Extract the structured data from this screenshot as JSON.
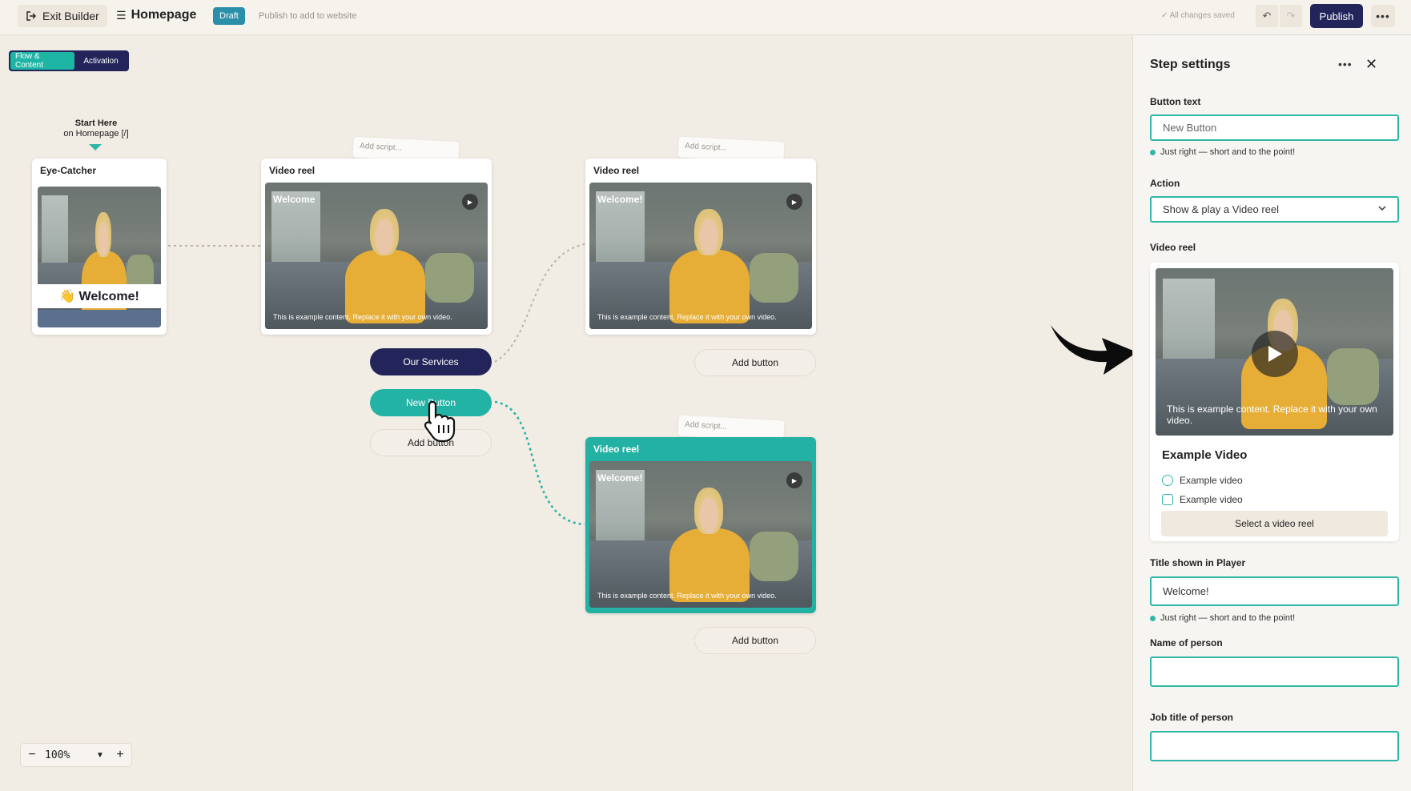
{
  "topbar": {
    "exit_label": "Exit Builder",
    "page_title": "Homepage",
    "draft_badge": "Draft",
    "publish_hint": "Publish to add to website",
    "saved_status": "✓ All changes saved",
    "undo_icon": "↶",
    "redo_icon": "↷",
    "publish_label": "Publish",
    "more_icon": "•••"
  },
  "mode_toggle": {
    "tabs": [
      {
        "label": "Flow & Content",
        "active": true
      },
      {
        "label": "Activation",
        "active": false
      }
    ]
  },
  "canvas": {
    "start": {
      "title": "Start Here",
      "subtitle": "on Homepage [/]"
    },
    "eye_catcher": {
      "title": "Eye-Catcher",
      "welcome": "👋 Welcome!"
    },
    "add_script_label": "Add script...",
    "video_nodes": [
      {
        "title": "Video reel",
        "video_title": "Welcome",
        "caption": "This is example content. Replace it with your own video."
      },
      {
        "title": "Video reel",
        "video_title": "Welcome!",
        "caption": "This is example content. Replace it with your own video."
      },
      {
        "title": "Video reel",
        "video_title": "Welcome!",
        "caption": "This is example content. Replace it with your own video."
      }
    ],
    "buttons": {
      "our_services": "Our Services",
      "new_button": "New Button",
      "add_button": "Add button"
    },
    "zoom": {
      "minus": "−",
      "value": "100%",
      "dropdown": "▼",
      "plus": "+"
    }
  },
  "panel": {
    "title": "Step settings",
    "more_icon": "•••",
    "close_icon": "✕",
    "button_text": {
      "label": "Button text",
      "placeholder": "New Button",
      "hint": "Just right — short and to the point!"
    },
    "action": {
      "label": "Action",
      "value": "Show & play a Video reel"
    },
    "video_reel": {
      "label": "Video reel",
      "caption": "This is example content. Replace it with your own video.",
      "name": "Example Video",
      "meta": [
        "Example video",
        "Example video"
      ],
      "select_label": "Select a video reel"
    },
    "title_in_player": {
      "label": "Title shown in Player",
      "value": "Welcome!",
      "hint": "Just right — short and to the point!"
    },
    "name_of_person": {
      "label": "Name of person",
      "value": ""
    },
    "job_title": {
      "label": "Job title of person",
      "value": ""
    }
  },
  "colors": {
    "accent": "#23b3a4",
    "navy": "#23255a",
    "background": "#f1ece4"
  }
}
